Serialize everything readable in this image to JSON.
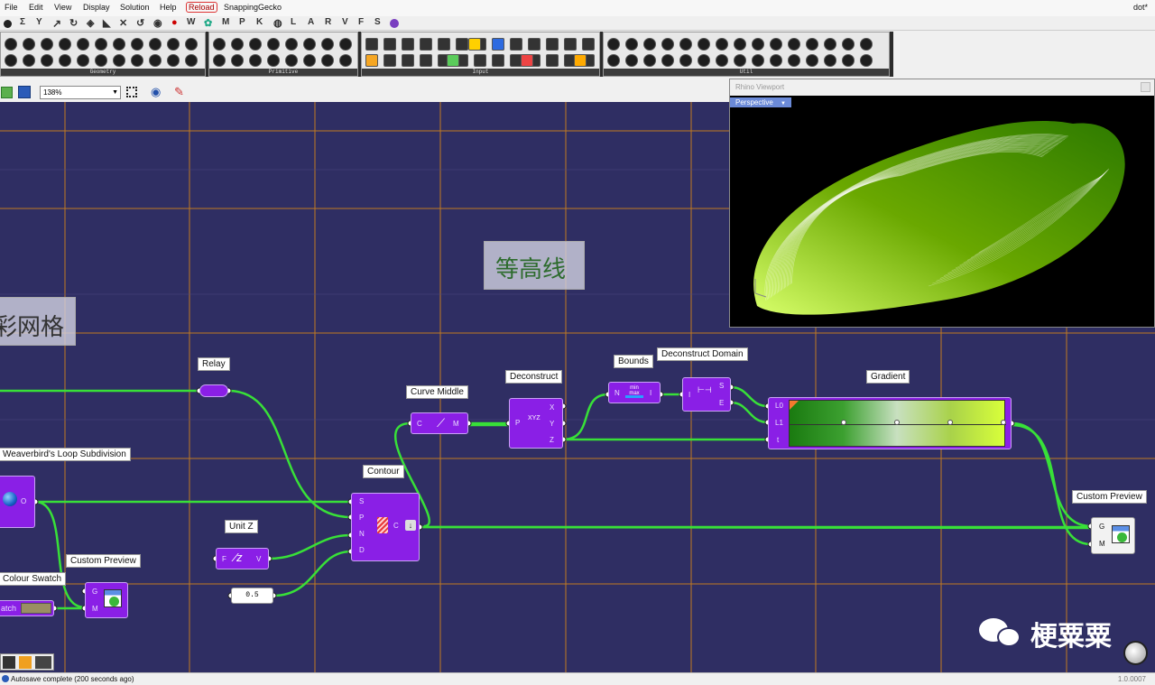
{
  "menubar": {
    "items": [
      "File",
      "Edit",
      "View",
      "Display",
      "Solution",
      "Help",
      "Reload",
      "SnappingGecko"
    ],
    "document": "dot*"
  },
  "tabs": [
    "Σ",
    "Y",
    "M",
    "P",
    "K",
    "L",
    "A",
    "R",
    "V",
    "F",
    "S",
    "W"
  ],
  "ribbon": {
    "panels": [
      "Geometry",
      "Primitive",
      "Input",
      "Util"
    ]
  },
  "toolbar": {
    "zoom": "138%"
  },
  "groups": {
    "contour_title": "等高线",
    "mesh_title": "彩网格"
  },
  "nodes": {
    "relay": {
      "label": "Relay"
    },
    "curve_middle": {
      "label": "Curve Middle",
      "in": "C",
      "out": "M"
    },
    "deconstruct": {
      "label": "Deconstruct",
      "in": "P",
      "out_x": "X",
      "out_y": "Y",
      "out_z": "Z"
    },
    "bounds": {
      "label": "Bounds",
      "in": "N",
      "out": "I"
    },
    "deconstruct_domain": {
      "label": "Deconstruct Domain",
      "in": "I",
      "out_s": "S",
      "out_e": "E"
    },
    "gradient": {
      "label": "Gradient",
      "in_l0": "L0",
      "in_l1": "L1",
      "in_t": "t"
    },
    "weaverbird": {
      "label": "Weaverbird's Loop Subdivision",
      "out": "O"
    },
    "contour": {
      "label": "Contour",
      "in_s": "S",
      "in_p": "P",
      "in_n": "N",
      "in_d": "D",
      "out": "C"
    },
    "unit_z": {
      "label": "Unit Z",
      "in": "F",
      "out": "V"
    },
    "number": {
      "value": "0.5"
    },
    "custom_preview_right": {
      "label": "Custom Preview",
      "in_g": "G",
      "in_m": "M"
    },
    "custom_preview_left": {
      "label": "Custom Preview",
      "in_g": "G",
      "in_m": "M"
    },
    "colour_swatch": {
      "label": "Colour Swatch",
      "text": "atch"
    }
  },
  "viewport": {
    "title": "Rhino Viewport",
    "view": "Perspective"
  },
  "status": {
    "text": "Autosave complete (200 seconds ago)",
    "version": "1.0.0007"
  },
  "watermark": "梗粟粟",
  "colors": {
    "canvas": "#2f2e63",
    "component": "#8a1fe6",
    "wire": "#38e038",
    "grid": "#c07a20"
  }
}
